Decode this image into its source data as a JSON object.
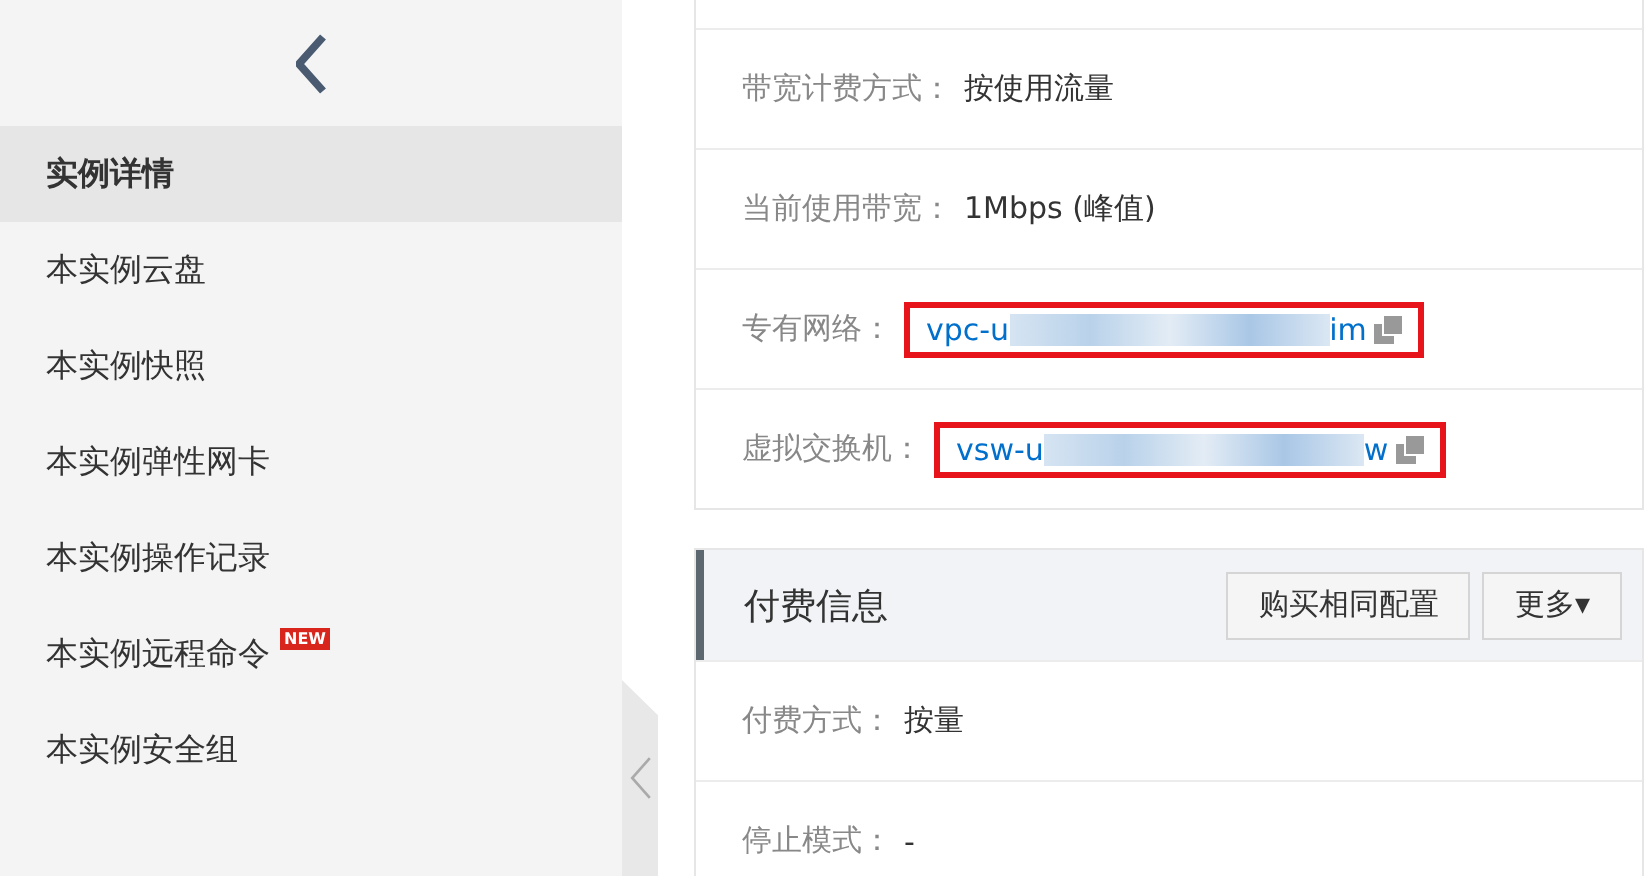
{
  "sidebar": {
    "items": [
      {
        "label": "实例详情",
        "selected": true
      },
      {
        "label": "本实例云盘",
        "selected": false
      },
      {
        "label": "本实例快照",
        "selected": false
      },
      {
        "label": "本实例弹性网卡",
        "selected": false
      },
      {
        "label": "本实例操作记录",
        "selected": false
      },
      {
        "label": "本实例远程命令",
        "selected": false,
        "badge": "NEW"
      },
      {
        "label": "本实例安全组",
        "selected": false
      }
    ]
  },
  "network": {
    "rows": [
      {
        "kind": "text",
        "label": "带宽计费方式：",
        "value": "按使用流量"
      },
      {
        "kind": "text",
        "label": "当前使用带宽：",
        "value": "1Mbps (峰值)"
      },
      {
        "kind": "link",
        "label": "专有网络：",
        "value_start": "vpc-u",
        "value_end": "im",
        "highlighted": true
      },
      {
        "kind": "link",
        "label": "虚拟交换机：",
        "value_start": "vsw-u",
        "value_end": "w",
        "highlighted": true
      }
    ]
  },
  "billing": {
    "title": "付费信息",
    "buttons": [
      "购买相同配置",
      "更多▾"
    ],
    "rows": [
      {
        "kind": "text",
        "label": "付费方式：",
        "value": "按量"
      },
      {
        "kind": "text",
        "label": "停止模式：",
        "value": "-"
      }
    ]
  }
}
